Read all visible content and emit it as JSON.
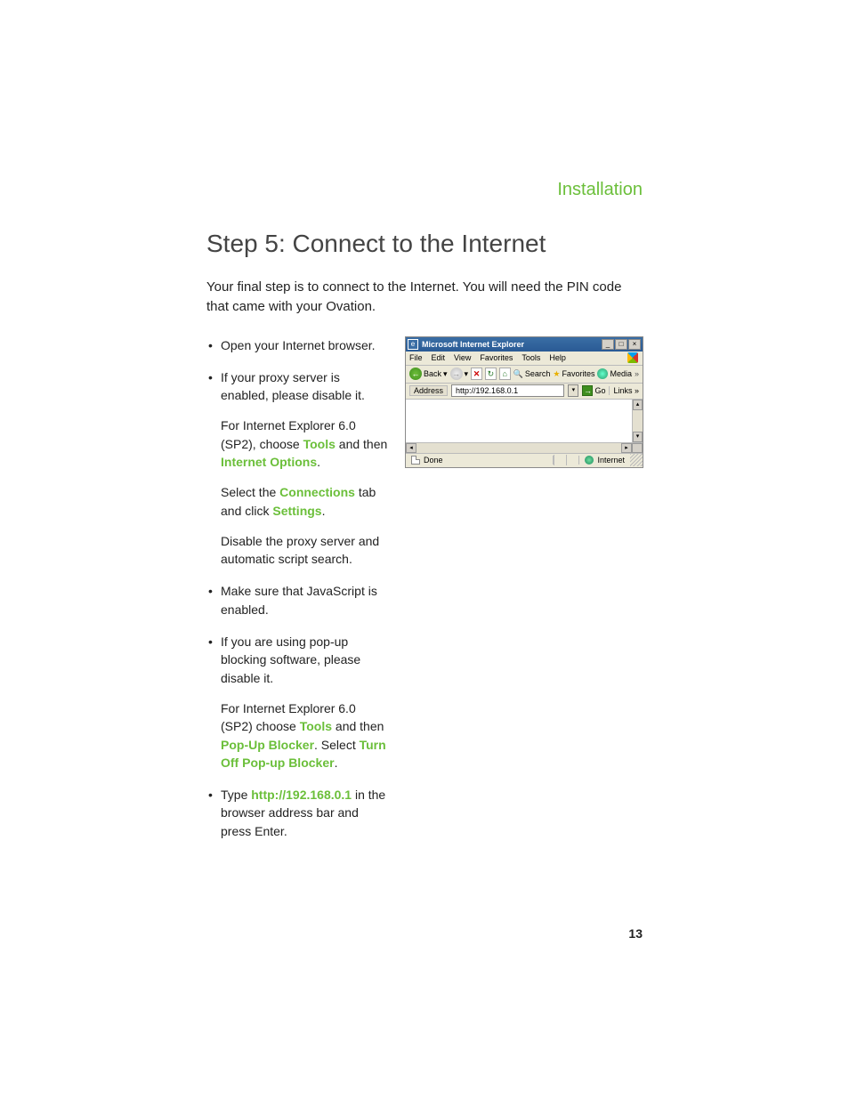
{
  "header": {
    "section": "Installation"
  },
  "title": "Step 5: Connect to the Internet",
  "intro": "Your final step is to connect to the Internet. You will need the PIN code that came with your Ovation.",
  "bullets": {
    "b1": "Open your Internet browser.",
    "b2": "If your proxy server is enabled, please disable it.",
    "b2s1a": "For Internet Explorer 6.0 (SP2), choose ",
    "b2s1_tools": "Tools",
    "b2s1b": " and then ",
    "b2s1_io": "Internet Options",
    "b2s1c": ".",
    "b2s2a": "Select the ",
    "b2s2_conn": "Connections",
    "b2s2b": " tab and click ",
    "b2s2_set": "Settings",
    "b2s2c": ".",
    "b2s3": "Disable the proxy server and automatic script search.",
    "b3": "Make sure that JavaScript is enabled.",
    "b4": "If you are using pop-up blocking software, please disable it.",
    "b4s1a": "For Internet Explorer 6.0 (SP2) choose ",
    "b4s1_tools": "Tools",
    "b4s1b": " and then ",
    "b4s1_pub": "Pop-Up Blocker",
    "b4s1c": ". Select ",
    "b4s1_toff": "Turn Off Pop-up Blocker",
    "b4s1d": ".",
    "b5a": "Type ",
    "b5_url": "http://192.168.0.1",
    "b5b": " in the browser address bar and press Enter."
  },
  "browser": {
    "title": "Microsoft Internet Explorer",
    "minimize": "_",
    "maximize": "□",
    "close": "×",
    "menu": {
      "file": "File",
      "edit": "Edit",
      "view": "View",
      "favorites": "Favorites",
      "tools": "Tools",
      "help": "Help"
    },
    "toolbar": {
      "back": "Back",
      "back_arrow": "←",
      "back_dd": "▾",
      "fwd_arrow": "→",
      "fwd_dd": "▾",
      "stop": "✕",
      "refresh": "↻",
      "home": "⌂",
      "search": "Search",
      "favorites": "Favorites",
      "media": "Media",
      "overflow": "»"
    },
    "address": {
      "label": "Address",
      "value": "http://192.168.0.1",
      "dd": "▾",
      "go_arrow": "→",
      "go": "Go",
      "links": "Links",
      "links_dd": "»"
    },
    "scroll": {
      "up": "▴",
      "down": "▾",
      "left": "◂",
      "right": "▸"
    },
    "status": {
      "done": "Done",
      "zone": "Internet"
    }
  },
  "page_number": "13"
}
